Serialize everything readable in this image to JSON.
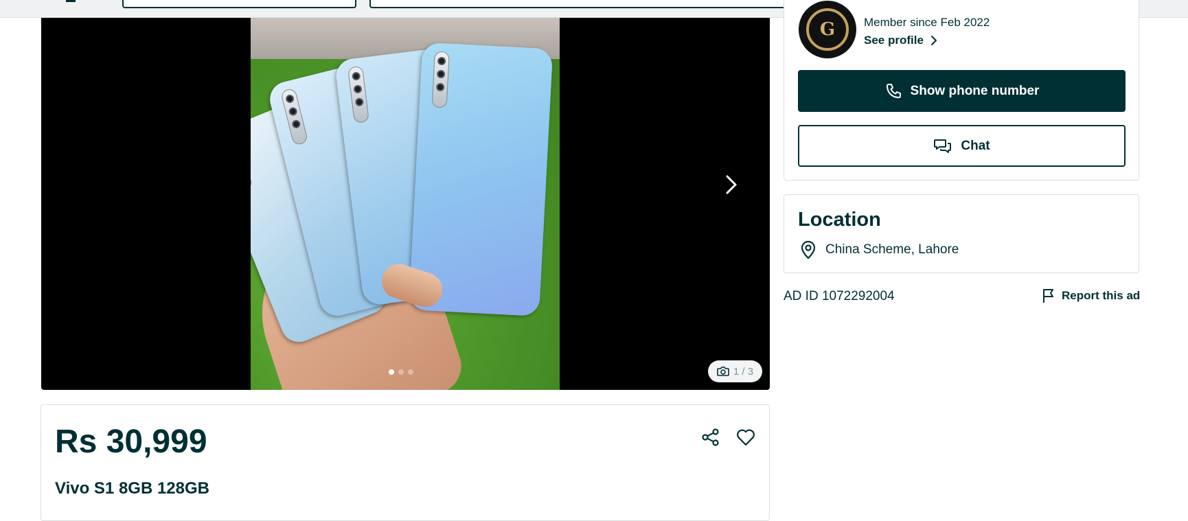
{
  "gallery": {
    "counter": "1 / 3",
    "total_dots": 3,
    "active_dot": 0
  },
  "listing": {
    "price": "Rs 30,999",
    "title": "Vivo S1 8GB 128GB"
  },
  "seller": {
    "member_since": "Member since Feb 2022",
    "see_profile_label": "See profile",
    "show_phone_label": "Show phone number",
    "chat_label": "Chat"
  },
  "location": {
    "heading": "Location",
    "place": "China Scheme, Lahore"
  },
  "ad": {
    "id_text": "AD ID 1072292004",
    "report_label": "Report this ad"
  },
  "colors": {
    "primary": "#002f34",
    "border": "#d8dfe0",
    "sell_yellow": "#ffce32",
    "sell_blue": "#3a77ff"
  },
  "icons": [
    "chevron-right-icon",
    "camera-icon",
    "share-icon",
    "heart-icon",
    "phone-icon",
    "chat-icon",
    "location-pin-icon",
    "flag-icon"
  ]
}
